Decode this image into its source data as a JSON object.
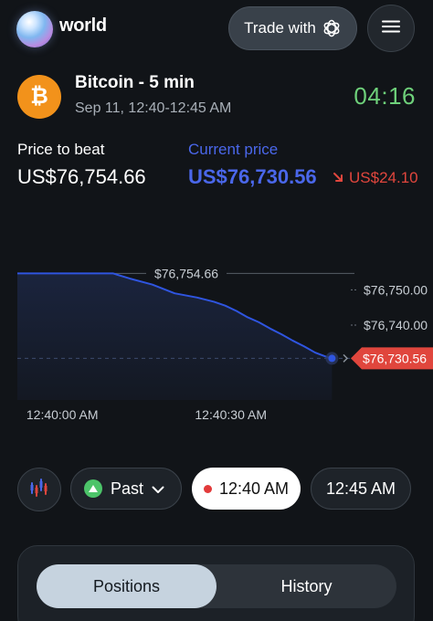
{
  "header": {
    "brand": "world",
    "trade_button": "Trade with",
    "trade_icon": "openai-icon",
    "menu_icon": "hamburger-menu-icon"
  },
  "market": {
    "icon_symbol": "₿",
    "title": "Bitcoin - 5 min",
    "subtitle": "Sep 11, 12:40-12:45 AM",
    "countdown": "04:16"
  },
  "prices": {
    "price_to_beat_label": "Price to beat",
    "price_to_beat_value": "US$76,754.66",
    "current_price_label": "Current price",
    "current_price_value": "US$76,730.56",
    "change_value": "US$24.10",
    "change_direction": "down"
  },
  "chart_data": {
    "type": "line",
    "target_label": "$76,754.66",
    "current_label": "$76,730.56",
    "y_tick_labels": [
      "$76,750.00",
      "$76,740.00"
    ],
    "x_tick_labels": [
      "12:40:00 AM",
      "12:40:30 AM"
    ],
    "y_ticks": [
      76750,
      76740
    ],
    "ylim": [
      76726,
      76762
    ],
    "target_value": 76754.66,
    "current_value": 76730.56,
    "x_seconds_range": [
      -8,
      52
    ],
    "x_tick_seconds": [
      0,
      30
    ],
    "series": [
      {
        "x": [
          -8,
          9,
          12,
          16,
          20,
          24,
          27,
          29,
          31,
          33,
          35,
          37,
          39,
          41,
          43,
          45,
          47,
          48
        ],
        "y": [
          76754.66,
          76754.66,
          76753.2,
          76751.5,
          76749.0,
          76747.8,
          76746.6,
          76745.5,
          76744.0,
          76742.2,
          76740.8,
          76739.0,
          76737.4,
          76735.6,
          76734.0,
          76732.2,
          76731.0,
          76730.56
        ]
      }
    ],
    "colors": {
      "line": "#2f55e0",
      "positive": "#6ed07a",
      "negative": "#e0463d"
    }
  },
  "controls": {
    "chart_type_icon": "candlestick-chart-icon",
    "past_label": "Past",
    "current_window": "12:40 AM",
    "next_window": "12:45 AM"
  },
  "panel": {
    "tabs": [
      "Positions",
      "History"
    ],
    "active_tab": "Positions"
  }
}
